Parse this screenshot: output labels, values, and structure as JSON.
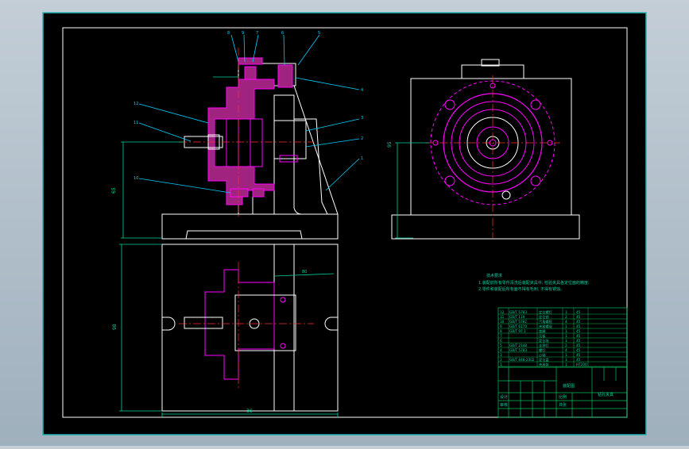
{
  "colors": {
    "background": "#000000",
    "outline": "#ffffff",
    "border": "#27b5b5",
    "dimension": "#00d2a0",
    "magenta": "#ff00ff",
    "pink_fill": "#a0237f",
    "centerline": "#ff3030",
    "leader": "#00cfff",
    "table_green": "#00c060"
  },
  "callouts_top": [
    "8",
    "9",
    "7",
    "6",
    "5"
  ],
  "callouts_side": [
    "4",
    "3",
    "2",
    "1",
    "12",
    "11",
    "10"
  ],
  "dims": {
    "height_left": "65",
    "height_right": "95",
    "height_bottom": "98",
    "width_bottom": "36",
    "flange": "80"
  },
  "notes": {
    "heading": "技术要求",
    "line1": "1.装配前所有零件清洗后装配夹具中, 检验夹具各定位面的精度;",
    "line2": "2.零件和装配后所有面不得有毛刺, 不得有锈蚀。"
  },
  "bom": [
    [
      "12",
      "GB/T 5783",
      "定位螺钉",
      "1",
      "45"
    ],
    [
      "11",
      "GB/T 119",
      "定位销",
      "2",
      "45"
    ],
    [
      "10",
      "GB/T 5782",
      "六角螺栓",
      "4",
      "45"
    ],
    [
      "9",
      "GB/T 6170",
      "夹紧螺母",
      "1",
      "45"
    ],
    [
      "8",
      "GB/T 97.1",
      "垫圈",
      "1",
      "45"
    ],
    [
      "7",
      "",
      "压板",
      "1",
      "45"
    ],
    [
      "6",
      "",
      "定位块",
      "1",
      "45"
    ],
    [
      "5",
      "GB/T 2148",
      "支承钉",
      "2",
      "45"
    ],
    [
      "4",
      "GB/T 5783",
      "螺钉",
      "4",
      "45"
    ],
    [
      "3",
      "",
      "心轴",
      "1",
      "45"
    ],
    [
      "2",
      "GB/T 848-2002",
      "定位盘",
      "1",
      "45"
    ],
    [
      "1",
      "",
      "夹具体",
      "1",
      "HT200"
    ]
  ],
  "title_block": {
    "name": "装配图",
    "drawing_no": "钻孔夹具",
    "label_design": "设计",
    "label_check": "审核",
    "label_scale": "比例",
    "label_sheet": "共张"
  }
}
